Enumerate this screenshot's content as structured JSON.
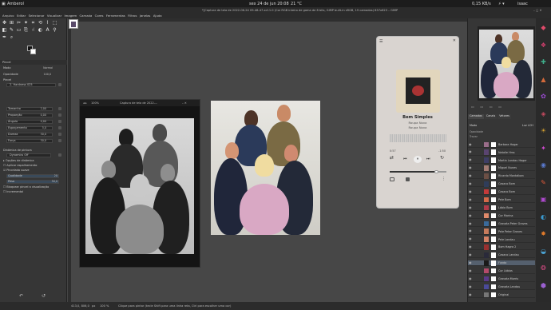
{
  "topbar": {
    "app_name": "Amberol",
    "datetime": "sex 24 de jun  20:08",
    "weather": "21 °C",
    "net": "0,15 KB/s",
    "user": "isaac"
  },
  "window": {
    "title": "*[Captura de tela de 2022-06-24 09-48-47.xcf-1.0 (Cor RGB inteiro de gama de 8 bits, GIMP built-in sRGB, 19 camadas) 837x623 – GIMP"
  },
  "menu": [
    "Arquivo",
    "Editar",
    "Selecionar",
    "Visualizar",
    "Imagem",
    "Camada",
    "Cores",
    "Ferramentas",
    "Filtros",
    "Janelas",
    "Ajuda"
  ],
  "tool_options": {
    "header": "Pincel",
    "mode_label": "Modo",
    "mode_value": "Normal",
    "opacity_label": "Opacidade",
    "brush_label": "Pincel",
    "brush_value": "2. Hardness 025",
    "rows": [
      {
        "label": "Tamanho",
        "value": "2,00"
      },
      {
        "label": "Proporção",
        "value": "0,00"
      },
      {
        "label": "Ângulo",
        "value": "0,00"
      },
      {
        "label": "Espaçamento",
        "value": "5,0"
      },
      {
        "label": "Dureza",
        "value": "50,0"
      },
      {
        "label": "Força",
        "value": "50,0"
      }
    ],
    "dynamics_label": "Dinâmica de pintura",
    "dynamics_value": "Dynamics Off",
    "checks": [
      "Opções de dinâmica",
      "Aplicar espalhamento",
      "Pincelada suave"
    ],
    "quality_label": "Qualidade",
    "quality_value": "20",
    "weight_label": "Peso",
    "weight_value": "50,0",
    "lock_label": "Bloquear pincel a visualização",
    "incremental": "Incremental"
  },
  "bw_window": {
    "zoom": "100%",
    "title": "Captura de tela de 2022-..."
  },
  "player": {
    "song": "Bem Simples",
    "artist": "Roupa Nova",
    "album": "Roupa Nova",
    "elapsed": "0:57",
    "remaining": "-1:50",
    "progress": 0.32,
    "volume": 0.82,
    "accent": "#c8c2bd"
  },
  "layers_panel": {
    "tabs": [
      "Camadas",
      "Canais",
      "Vetores"
    ],
    "mode_label": "Modo",
    "mode_value": "Luz LCH",
    "opacity_label": "Opacidade",
    "lock_label": "Travar",
    "layers": [
      {
        "name": "Barbara Hagar",
        "color": "#9a6d8a"
      },
      {
        "name": "Natalie Hrss",
        "color": "#5a4470"
      },
      {
        "name": "Martin Landau Hagar",
        "color": "#3e3e66"
      },
      {
        "name": "Miguel Nunes",
        "color": "#a47c74"
      },
      {
        "name": "Ricardo Montalban",
        "color": "#6c4f45"
      },
      {
        "name": "Casaco Bom",
        "color": "#2f3d5a"
      },
      {
        "name": "Casaco Bom",
        "color": "#c43a3a"
      },
      {
        "name": "Pele Bom",
        "color": "#d46a4a"
      },
      {
        "name": "Lábia Bom",
        "color": "#b03a4a"
      },
      {
        "name": "Cor Marina",
        "color": "#e08a6a"
      },
      {
        "name": "Gravata Peter Graves",
        "color": "#3a6a9a"
      },
      {
        "name": "Pele Peter Graves",
        "color": "#c67b5c"
      },
      {
        "name": "Pele Landau",
        "color": "#d48266"
      },
      {
        "name": "Bom Hagra 2",
        "color": "#9a3030"
      },
      {
        "name": "Casaco Landau",
        "color": "#2a2a3a"
      },
      {
        "name": "Fundo",
        "color": "#1a1a1a",
        "selected": true
      },
      {
        "name": "Cor Lábios",
        "color": "#b44a6a"
      },
      {
        "name": "Gravata Morris",
        "color": "#5a3a8a"
      },
      {
        "name": "Gravata Landau",
        "color": "#4a4a9a"
      },
      {
        "name": "Original",
        "color": "#777777"
      }
    ]
  },
  "status": {
    "coords": "413,0, 806,0",
    "unit": "px",
    "zoom": "100 %",
    "hint": "Clique para pintar (tecle Shift para uma linha reta, Ctrl para escolher uma cor)"
  },
  "launcher_colors": [
    "#e04a6a",
    "#d94070",
    "#3fae8a",
    "#d46a3a",
    "#9a4ad0",
    "#c84a60",
    "#d4a030",
    "#d04ad0",
    "#5a7ad0",
    "#e05a3a",
    "#b04ad0",
    "#3a9ad0",
    "#e07a2a",
    "#4aa0d0",
    "#d04a80",
    "#9a60d0"
  ]
}
